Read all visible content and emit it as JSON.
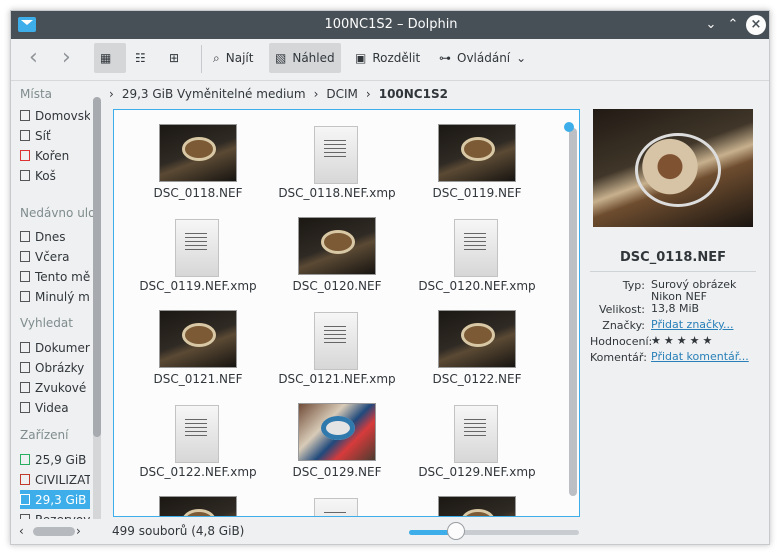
{
  "window": {
    "title": "100NC1S2 – Dolphin"
  },
  "toolbar": {
    "find": "Najít",
    "preview": "Náhled",
    "split": "Rozdělit",
    "controls": "Ovládání"
  },
  "sidebar": {
    "sections": [
      {
        "title": "Místa",
        "items": [
          "Domovsk",
          "Síť",
          "Kořen",
          "Koš"
        ]
      },
      {
        "title": "Nedávno ulo",
        "items": [
          "Dnes",
          "Včera",
          "Tento mě",
          "Minulý m"
        ]
      },
      {
        "title": "Vyhledat",
        "items": [
          "Dokumer",
          "Obrázky",
          "Zvukové",
          "Videa"
        ]
      },
      {
        "title": "Zařízení",
        "items": [
          "25,9 GiB",
          "CIVILIZAT",
          "29,3 GiB",
          "Rezervov"
        ]
      }
    ]
  },
  "breadcrumb": [
    "29,3 GiB Vyměnitelné medium",
    "DCIM",
    "100NC1S2"
  ],
  "files": [
    "DSC_0118.NEF",
    "DSC_0118.NEF.xmp",
    "DSC_0119.NEF",
    "DSC_0119.NEF.xmp",
    "DSC_0120.NEF",
    "DSC_0120.NEF.xmp",
    "DSC_0121.NEF",
    "DSC_0121.NEF.xmp",
    "DSC_0122.NEF",
    "DSC_0122.NEF.xmp",
    "DSC_0129.NEF",
    "DSC_0129.NEF.xmp"
  ],
  "preview": {
    "name": "DSC_0118.NEF",
    "meta": [
      {
        "label": "Typ:",
        "value": "Surový obrázek Nikon NEF"
      },
      {
        "label": "Velikost:",
        "value": "13,8 MiB"
      },
      {
        "label": "Značky:",
        "value": "Přidat značky..."
      },
      {
        "label": "Hodnocení:",
        "value": "★★★★★"
      },
      {
        "label": "Komentář:",
        "value": "Přidat komentář..."
      }
    ]
  },
  "status": {
    "summary": "499 souborů (4,8 GiB)",
    "zoom_level": 0.27
  }
}
